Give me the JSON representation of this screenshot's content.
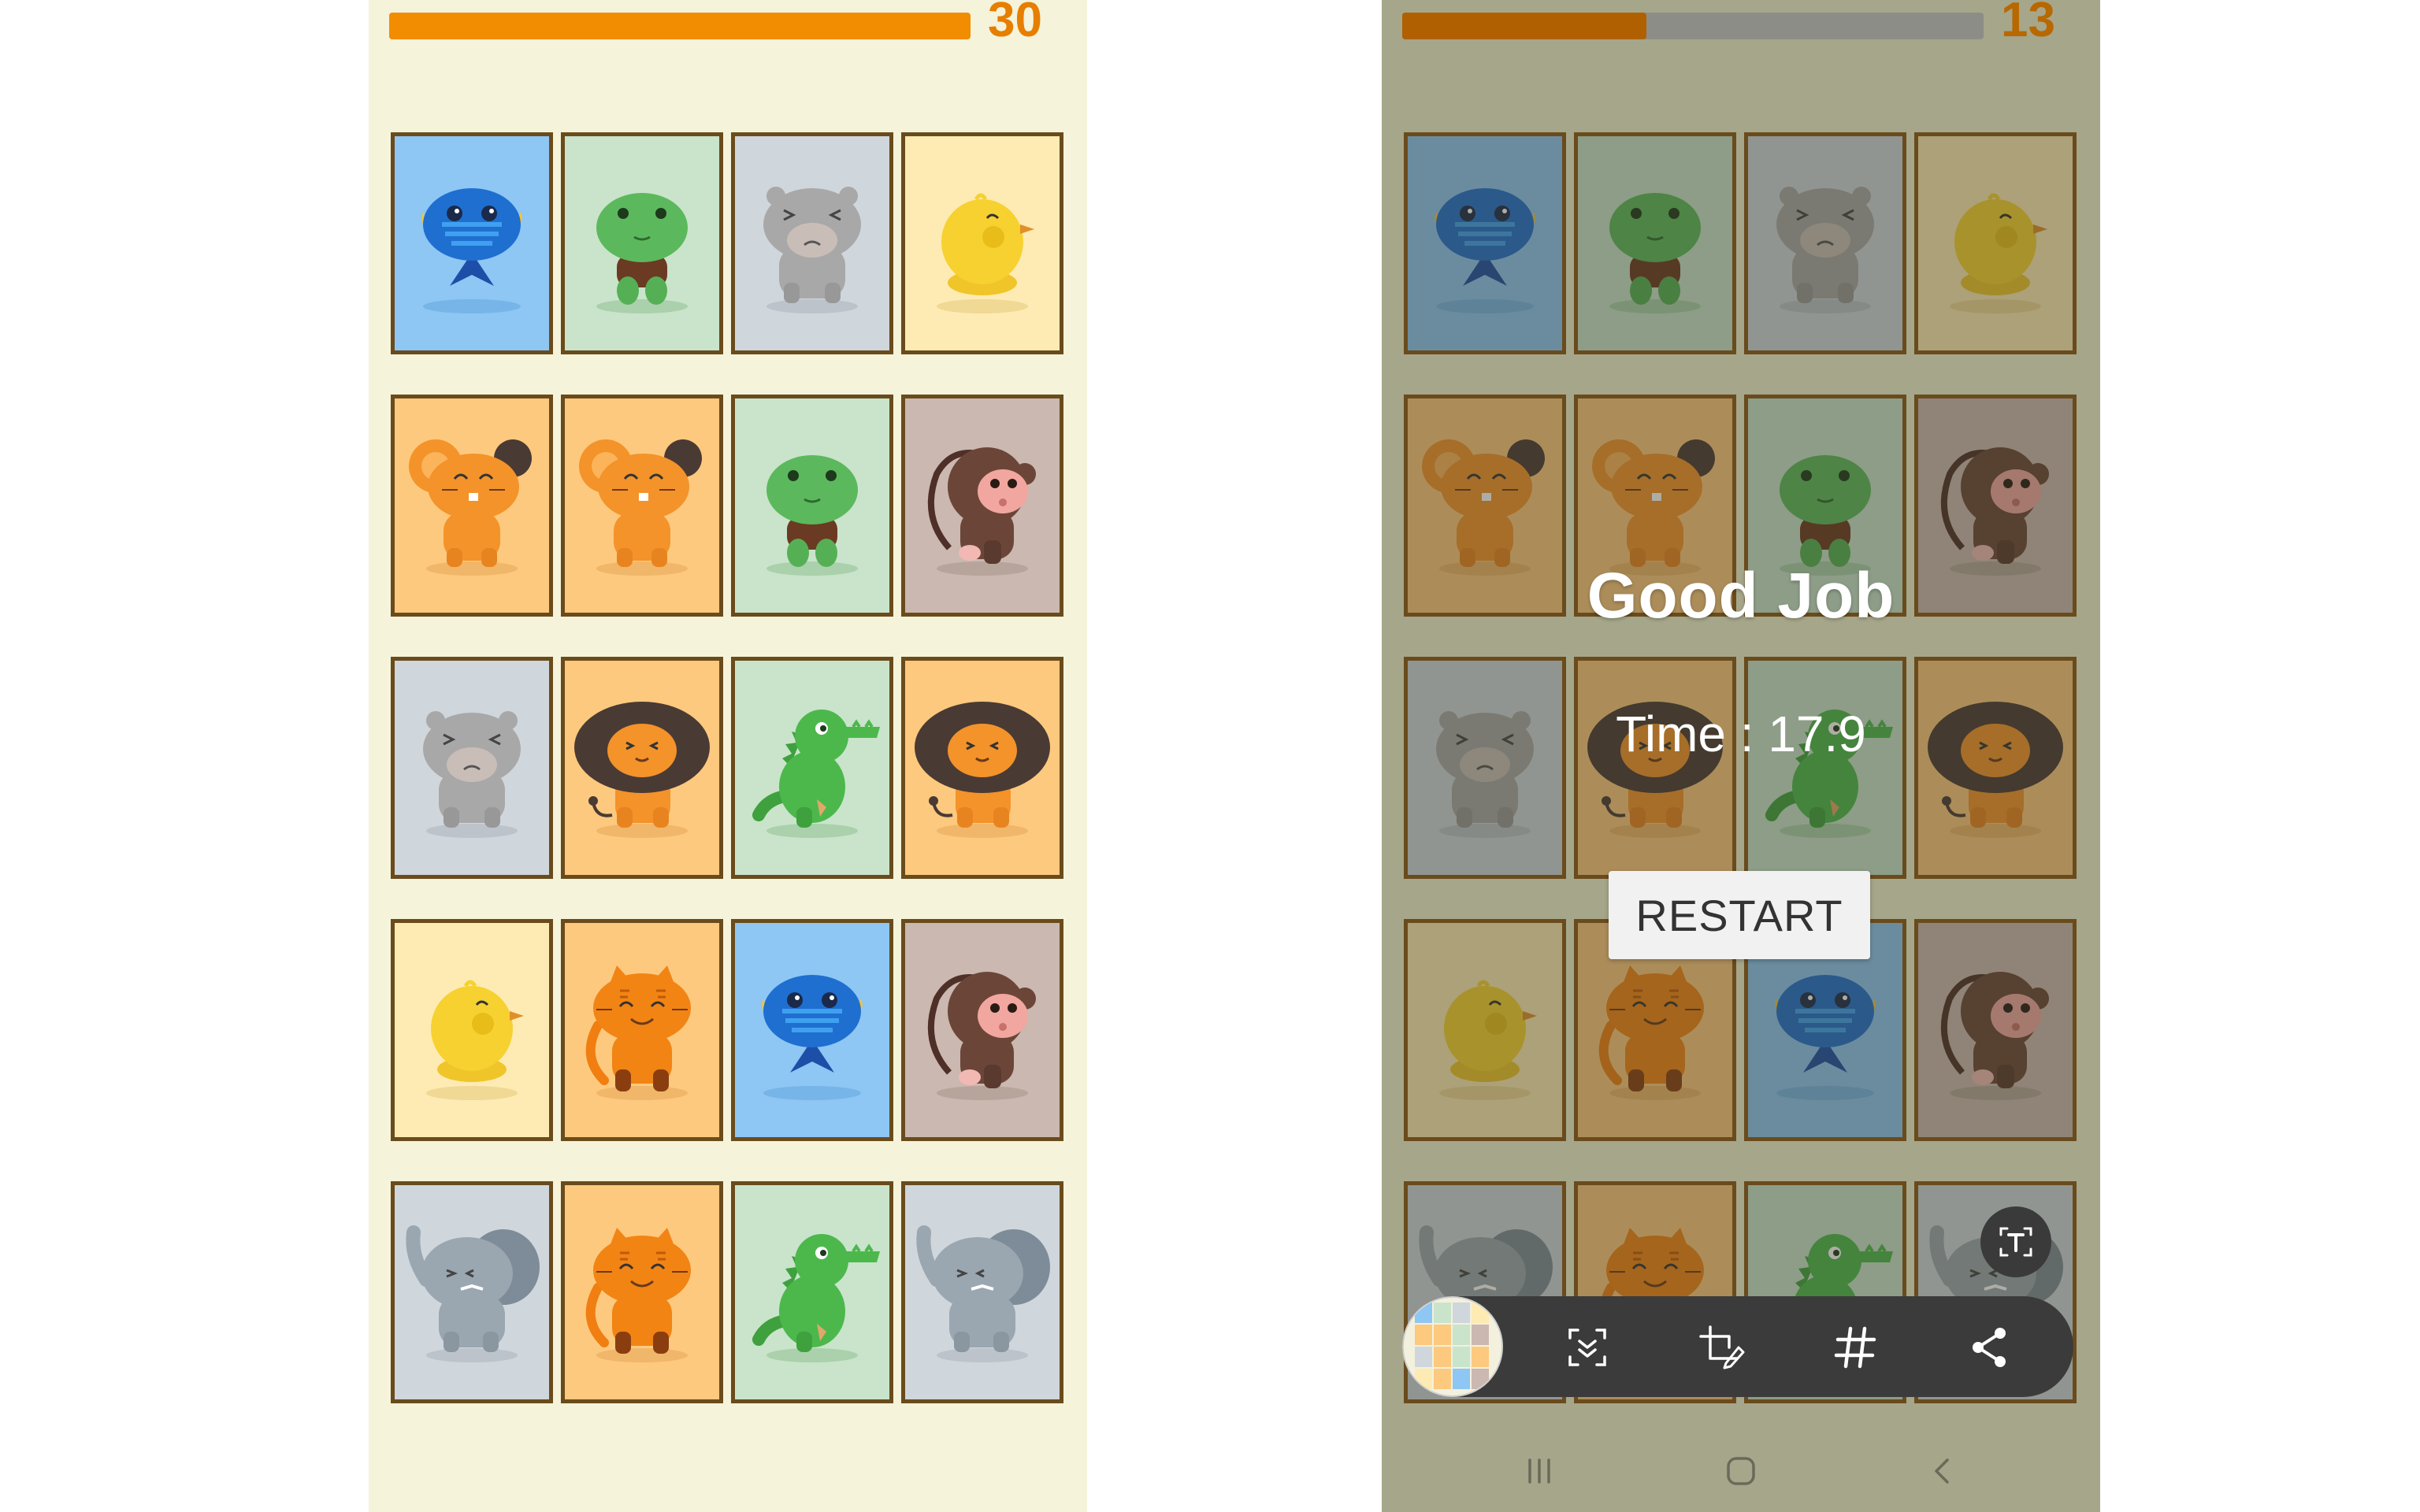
{
  "left_screen": {
    "timer": {
      "value": "30",
      "fill_fraction": 1.0,
      "fill_color": "#f28c00",
      "number_color": "#e67e00"
    },
    "background": "#f5f3da",
    "cards": [
      [
        "fish",
        "frog",
        "hippo",
        "chick"
      ],
      [
        "mouse",
        "mouse",
        "frog",
        "monkey"
      ],
      [
        "hippo",
        "lion",
        "crocodile",
        "lion"
      ],
      [
        "chick",
        "tiger",
        "fish",
        "monkey"
      ],
      [
        "elephant",
        "tiger",
        "crocodile",
        "elephant"
      ]
    ]
  },
  "right_screen": {
    "timer": {
      "value": "13",
      "fill_fraction": 0.42,
      "fill_color": "#b06000",
      "number_color": "#b86800"
    },
    "background": "#a6a68a",
    "cards": [
      [
        "fish",
        "frog",
        "hippo",
        "chick"
      ],
      [
        "mouse",
        "mouse",
        "frog",
        "monkey"
      ],
      [
        "hippo",
        "lion",
        "crocodile",
        "lion"
      ],
      [
        "chick",
        "tiger",
        "fish",
        "monkey"
      ],
      [
        "elephant",
        "tiger",
        "crocodile",
        "elephant"
      ]
    ],
    "dialog": {
      "title": "Good Job",
      "time_text": "Time : 17.9",
      "restart_label": "RESTART"
    },
    "screenshot_toolbar": {
      "icons": [
        "thumbnail-preview",
        "scroll-capture-icon",
        "crop-edit-icon",
        "hashtag-icon",
        "share-icon"
      ],
      "floating_icon": "extract-text-icon"
    },
    "navbar": {
      "icons": [
        "recent-apps-icon",
        "home-icon",
        "back-icon"
      ]
    }
  },
  "card_colors": {
    "fish": "#8ec6f4",
    "frog": "#c9e4cb",
    "hippo": "#cfd6dc",
    "chick": "#feebb3",
    "mouse": "#fdc97e",
    "monkey": "#cbb8b0",
    "lion": "#fdc97e",
    "crocodile": "#c9e4cb",
    "tiger": "#fdc97e",
    "elephant": "#cfd6dc"
  }
}
